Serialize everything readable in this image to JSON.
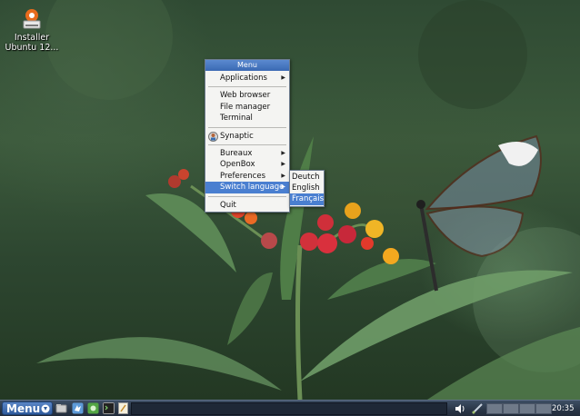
{
  "desktop": {
    "icon_label": "Installer Ubuntu 12..."
  },
  "menu": {
    "title": "Menu",
    "items": [
      {
        "label": "Applications",
        "submenu": true
      },
      {
        "label": "Web browser",
        "submenu": false
      },
      {
        "label": "File manager",
        "submenu": false
      },
      {
        "label": "Terminal",
        "submenu": false
      },
      {
        "label": "Synaptic",
        "submenu": false,
        "icon": "synaptic-icon"
      },
      {
        "label": "Bureaux",
        "submenu": true
      },
      {
        "label": "OpenBox",
        "submenu": true
      },
      {
        "label": "Preferences",
        "submenu": true
      },
      {
        "label": "Switch language",
        "submenu": true,
        "active": true
      },
      {
        "label": "Quit",
        "submenu": false
      }
    ],
    "arrow_glyph": "▶"
  },
  "language_submenu": {
    "items": [
      {
        "label": "Deutch"
      },
      {
        "label": "English"
      },
      {
        "label": "Français",
        "active": true
      }
    ]
  },
  "taskbar": {
    "menu_label": "Menu",
    "launchers": [
      "file-manager-icon",
      "web-browser-icon",
      "software-center-icon",
      "terminal-icon",
      "text-editor-icon"
    ],
    "tray_icons": [
      "volume-icon",
      "network-icon"
    ],
    "pager_count": 4,
    "clock": "20:35"
  },
  "colors": {
    "menu_highlight": "#4a7fd0",
    "menu_title": "#3a69b3",
    "taskbar": "#2a3647"
  }
}
